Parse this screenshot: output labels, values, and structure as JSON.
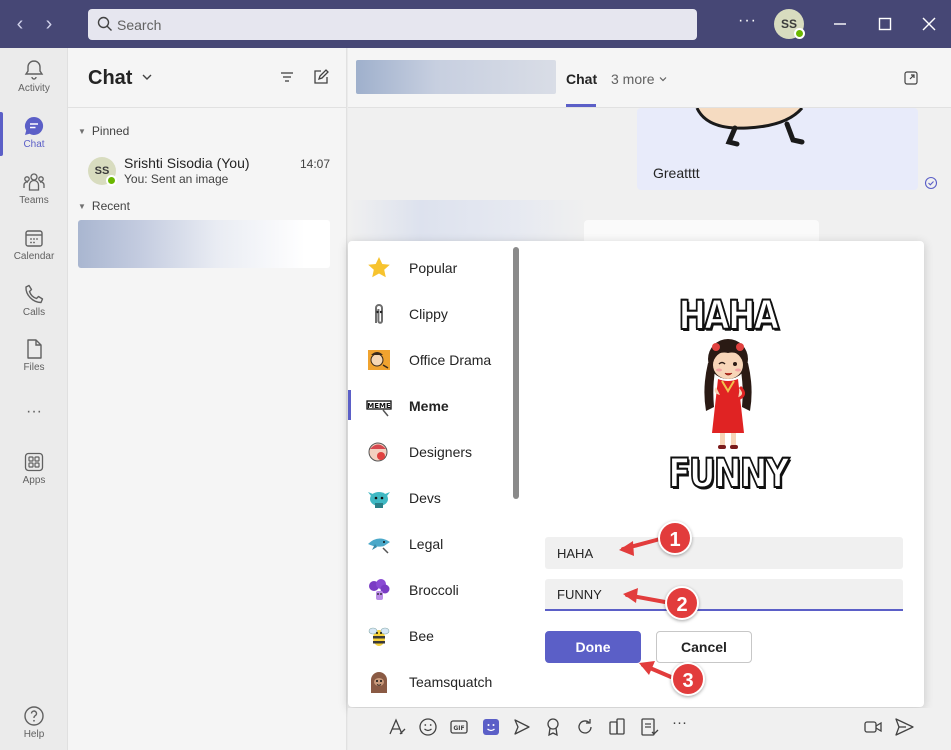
{
  "titlebar": {
    "search_placeholder": "Search",
    "more": "···",
    "avatar_initials": "SS"
  },
  "rail": {
    "items": [
      {
        "label": "Activity",
        "icon": "bell-icon"
      },
      {
        "label": "Chat",
        "icon": "chat-icon"
      },
      {
        "label": "Teams",
        "icon": "teams-icon"
      },
      {
        "label": "Calendar",
        "icon": "calendar-icon"
      },
      {
        "label": "Calls",
        "icon": "phone-icon"
      },
      {
        "label": "Files",
        "icon": "file-icon"
      },
      {
        "label": "Apps",
        "icon": "apps-icon"
      },
      {
        "label": "Help",
        "icon": "help-icon"
      }
    ],
    "more": "···"
  },
  "chatlist": {
    "title": "Chat",
    "pinned_label": "Pinned",
    "recent_label": "Recent",
    "pinned_chat": {
      "initials": "SS",
      "name": "Srishti Sisodia (You)",
      "preview": "You: Sent an image",
      "time": "14:07"
    }
  },
  "main": {
    "tab_chat": "Chat",
    "tab_more": "3 more",
    "message_text": "Greatttt"
  },
  "picker": {
    "categories": [
      {
        "label": "Popular",
        "icon": "star-icon"
      },
      {
        "label": "Clippy",
        "icon": "paperclip-icon"
      },
      {
        "label": "Office Drama",
        "icon": "office-drama-icon"
      },
      {
        "label": "Meme",
        "icon": "meme-icon",
        "selected": true
      },
      {
        "label": "Designers",
        "icon": "designers-icon"
      },
      {
        "label": "Devs",
        "icon": "devs-icon"
      },
      {
        "label": "Legal",
        "icon": "legal-icon"
      },
      {
        "label": "Broccoli",
        "icon": "broccoli-icon"
      },
      {
        "label": "Bee",
        "icon": "bee-icon"
      },
      {
        "label": "Teamsquatch",
        "icon": "teamsquatch-icon"
      }
    ],
    "meme_top": "HAHA",
    "meme_bottom": "FUNNY",
    "field_top_value": "HAHA",
    "field_bottom_value": "FUNNY",
    "done_label": "Done",
    "cancel_label": "Cancel"
  },
  "annotations": [
    "1",
    "2",
    "3"
  ],
  "colors": {
    "titlebar": "#464775",
    "accent": "#5b5fc7",
    "annotation": "#e23c3c"
  }
}
